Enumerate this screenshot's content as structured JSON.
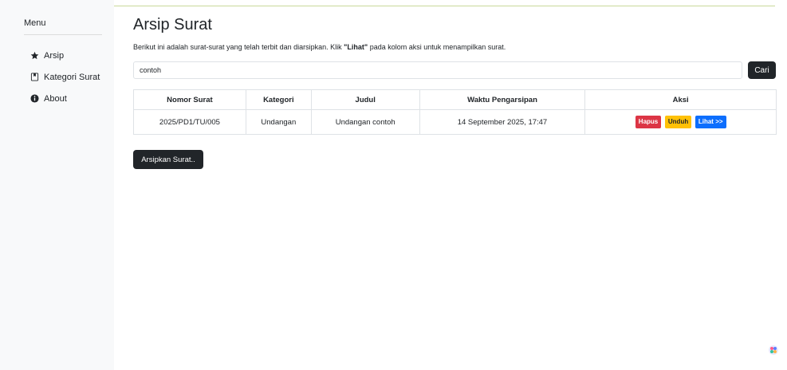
{
  "sidebar": {
    "title": "Menu",
    "items": [
      {
        "label": "Arsip",
        "icon": "star-icon"
      },
      {
        "label": "Kategori Surat",
        "icon": "bookmark-icon"
      },
      {
        "label": "About",
        "icon": "info-circle-icon"
      }
    ]
  },
  "main": {
    "title": "Arsip Surat",
    "description_before": "Berikut ini adalah surat-surat yang telah terbit dan diarsipkan. Klik ",
    "description_bold": "\"Lihat\"",
    "description_after": " pada kolom aksi untuk menampilkan surat.",
    "search": {
      "value": "contoh",
      "button_label": "Cari"
    },
    "table": {
      "headers": [
        "Nomor Surat",
        "Kategori",
        "Judul",
        "Waktu Pengarsipan",
        "Aksi"
      ],
      "rows": [
        {
          "nomor": "2025/PD1/TU/005",
          "kategori": "Undangan",
          "judul": "Undangan contoh",
          "waktu": "14 September 2025, 17:47"
        }
      ],
      "actions": {
        "delete": "Hapus",
        "download": "Unduh",
        "view": "Lihat >>"
      }
    },
    "archive_button": "Arsipkan Surat.."
  },
  "colors": {
    "danger": "#dc3545",
    "warning": "#ffc107",
    "primary": "#0d6efd",
    "dark": "#212529"
  }
}
